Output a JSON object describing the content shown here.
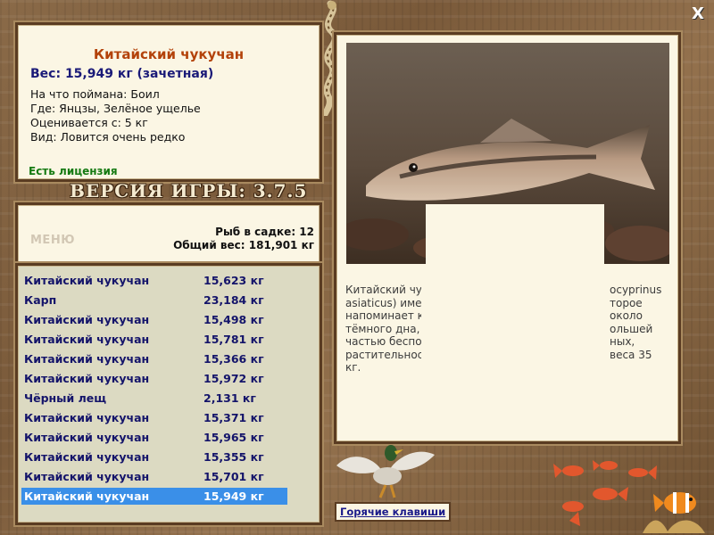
{
  "fish_info": {
    "title": "Китайский чукучан",
    "weight_line": "Вес: 15,949 кг (зачетная)",
    "bait_line": "На что поймана: Боил",
    "location_line": "Где: Янцзы, Зелёное ущелье",
    "rated_line": "Оценивается с: 5 кг",
    "rarity_line": "Вид: Ловится очень редко",
    "license": "Есть лицензия"
  },
  "version": "ВЕРСИЯ ИГРЫ: 3.7.5",
  "keepnet": {
    "menu_label": "МЕНЮ",
    "count": "Рыб в садке: 12",
    "total": "Общий вес: 181,901 кг"
  },
  "catch_list": [
    {
      "name": "Китайский чукучан",
      "weight": "15,623 кг"
    },
    {
      "name": "Карп",
      "weight": "23,184 кг"
    },
    {
      "name": "Китайский чукучан",
      "weight": "15,498 кг"
    },
    {
      "name": "Китайский чукучан",
      "weight": "15,781 кг"
    },
    {
      "name": "Китайский чукучан",
      "weight": "15,366 кг"
    },
    {
      "name": "Китайский чукучан",
      "weight": "15,972 кг"
    },
    {
      "name": "Чёрный лещ",
      "weight": "2,131 кг"
    },
    {
      "name": "Китайский чукучан",
      "weight": "15,371 кг"
    },
    {
      "name": "Китайский чукучан",
      "weight": "15,965 кг"
    },
    {
      "name": "Китайский чукучан",
      "weight": "15,355 кг"
    },
    {
      "name": "Китайский чукучан",
      "weight": "15,701 кг"
    },
    {
      "name": "Китайский чукучан",
      "weight": "15,949 кг"
    }
  ],
  "selected_index": 11,
  "description": {
    "lines": [
      "Китайский чу",
      "asiaticus) име",
      "напоминает к",
      "тёмного дна,",
      "частью беспол",
      "растительност",
      "кг."
    ],
    "lines_right": [
      "ocyprinus",
      "торое",
      "около",
      "ольшей",
      "ных,",
      "веса 35"
    ]
  },
  "hotkeys_label": "Горячие клавиши",
  "close_label": "X",
  "colors": {
    "selected_row": "#3a8fe8",
    "title": "#b3420a",
    "license": "#157a12",
    "list_text": "#14146a"
  }
}
